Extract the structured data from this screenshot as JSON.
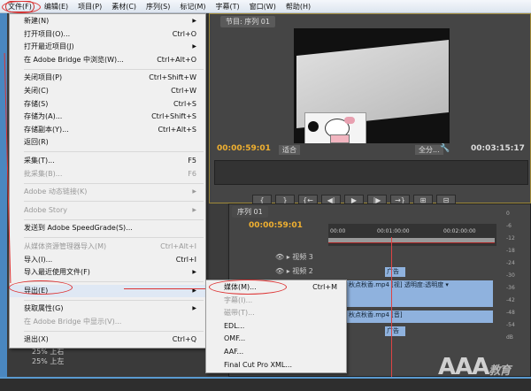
{
  "menubar": [
    "文件(F)",
    "编辑(E)",
    "项目(P)",
    "素材(C)",
    "序列(S)",
    "标记(M)",
    "字幕(T)",
    "窗口(W)",
    "帮助(H)"
  ],
  "file_menu": [
    {
      "label": "新建(N)",
      "shortcut": "",
      "submenu": true
    },
    {
      "label": "打开项目(O)...",
      "shortcut": "Ctrl+O"
    },
    {
      "label": "打开最近项目(J)",
      "shortcut": "",
      "submenu": true
    },
    {
      "label": "在 Adobe Bridge 中浏览(W)...",
      "shortcut": "Ctrl+Alt+O"
    },
    {
      "sep": true
    },
    {
      "label": "关闭项目(P)",
      "shortcut": "Ctrl+Shift+W"
    },
    {
      "label": "关闭(C)",
      "shortcut": "Ctrl+W"
    },
    {
      "label": "存储(S)",
      "shortcut": "Ctrl+S"
    },
    {
      "label": "存储为(A)...",
      "shortcut": "Ctrl+Shift+S"
    },
    {
      "label": "存储副本(Y)...",
      "shortcut": "Ctrl+Alt+S"
    },
    {
      "label": "返回(R)",
      "shortcut": ""
    },
    {
      "sep": true
    },
    {
      "label": "采集(T)...",
      "shortcut": "F5"
    },
    {
      "label": "批采集(B)...",
      "shortcut": "F6",
      "disabled": true
    },
    {
      "sep": true
    },
    {
      "label": "Adobe 动态链接(K)",
      "shortcut": "",
      "submenu": true,
      "disabled": true
    },
    {
      "sep": true
    },
    {
      "label": "Adobe Story",
      "shortcut": "",
      "submenu": true,
      "disabled": true
    },
    {
      "sep": true
    },
    {
      "label": "发送到 Adobe SpeedGrade(S)...",
      "shortcut": ""
    },
    {
      "sep": true
    },
    {
      "label": "从媒体资源管理器导入(M)",
      "shortcut": "Ctrl+Alt+I",
      "disabled": true
    },
    {
      "label": "导入(I)...",
      "shortcut": "Ctrl+I"
    },
    {
      "label": "导入最近使用文件(F)",
      "shortcut": "",
      "submenu": true
    },
    {
      "sep": true
    },
    {
      "label": "导出(E)",
      "shortcut": "",
      "submenu": true,
      "highlighted": true
    },
    {
      "sep": true
    },
    {
      "label": "获取属性(G)",
      "shortcut": "",
      "submenu": true
    },
    {
      "label": "在 Adobe Bridge 中显示(V)...",
      "shortcut": "",
      "disabled": true
    },
    {
      "sep": true
    },
    {
      "label": "退出(X)",
      "shortcut": "Ctrl+Q"
    }
  ],
  "export_submenu": [
    {
      "label": "媒体(M)...",
      "shortcut": "Ctrl+M"
    },
    {
      "label": "字幕(I)...",
      "shortcut": "",
      "disabled": true
    },
    {
      "label": "磁带(T)...",
      "shortcut": "",
      "disabled": true
    },
    {
      "label": "EDL...",
      "shortcut": ""
    },
    {
      "label": "OMF...",
      "shortcut": ""
    },
    {
      "label": "AAF...",
      "shortcut": ""
    },
    {
      "label": "Final Cut Pro XML...",
      "shortcut": ""
    }
  ],
  "monitor": {
    "tab": "节目: 序列 01",
    "timecode": "00:00:59:01",
    "zoom": "适合",
    "quality": "全分...",
    "duration": "00:03:15:17",
    "buttons": [
      "{",
      "}",
      "{←",
      "◀|",
      "▶",
      "|▶",
      "→}",
      "⊞",
      "⊟"
    ]
  },
  "timeline": {
    "tab": "序列 01",
    "timecode": "00:00:59:01",
    "ruler": [
      "00:00",
      "00:01:00:00",
      "00:02:00:00"
    ],
    "tracks": [
      "视频 3",
      "视频 2"
    ],
    "clips": {
      "ad1": "广告",
      "video": "秋点秋香.mp4 [视] 透明度:透明度 ▾",
      "audio": "秋点秋香.mp4 [音]",
      "ad2": "广告"
    }
  },
  "meter": [
    "0",
    "-6",
    "-12",
    "-18",
    "-24",
    "-30",
    "-36",
    "-42",
    "-48",
    "-54",
    "dB"
  ],
  "project": {
    "items": [
      "25% 上右",
      "25% 上左"
    ]
  },
  "watermark": {
    "main": "AAA",
    "sub": "教育"
  },
  "colors": {
    "timecode": "#f0b030",
    "annotation": "#dd3333",
    "clip": "#8fb2de"
  }
}
